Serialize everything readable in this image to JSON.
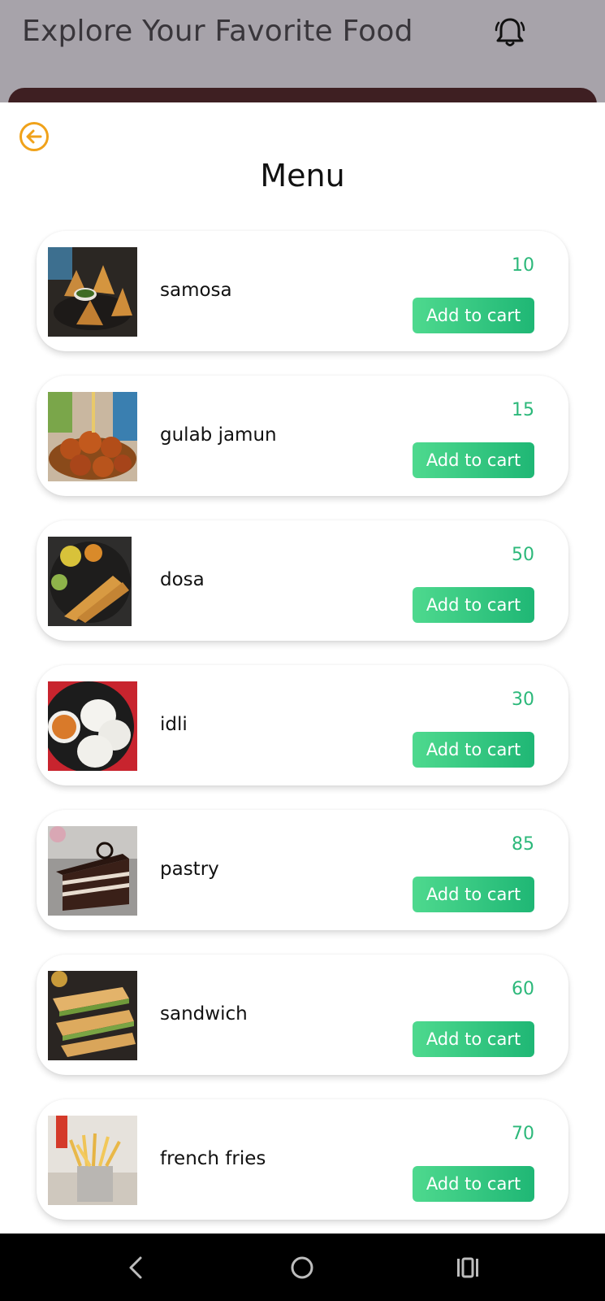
{
  "background_header": {
    "title": "Explore Your Favorite Food",
    "bell_icon": "bell-icon"
  },
  "sheet": {
    "back_icon": "arrow-left-circle-icon",
    "title": "Menu"
  },
  "colors": {
    "accent_orange": "#f0a21a",
    "price_green": "#2cb87a",
    "button_green_start": "#4ed98e",
    "button_green_end": "#1fb775"
  },
  "items": [
    {
      "name": "samosa",
      "price": "10",
      "button_label": "Add to cart"
    },
    {
      "name": "gulab jamun",
      "price": "15",
      "button_label": "Add to cart"
    },
    {
      "name": "dosa",
      "price": "50",
      "button_label": "Add to cart"
    },
    {
      "name": "idli",
      "price": "30",
      "button_label": "Add to cart"
    },
    {
      "name": "pastry",
      "price": "85",
      "button_label": "Add to cart"
    },
    {
      "name": "sandwich",
      "price": "60",
      "button_label": "Add to cart"
    },
    {
      "name": "french fries",
      "price": "70",
      "button_label": "Add to cart"
    }
  ],
  "nav": {
    "back_icon": "nav-back-icon",
    "home_icon": "nav-home-icon",
    "recents_icon": "nav-recents-icon"
  }
}
